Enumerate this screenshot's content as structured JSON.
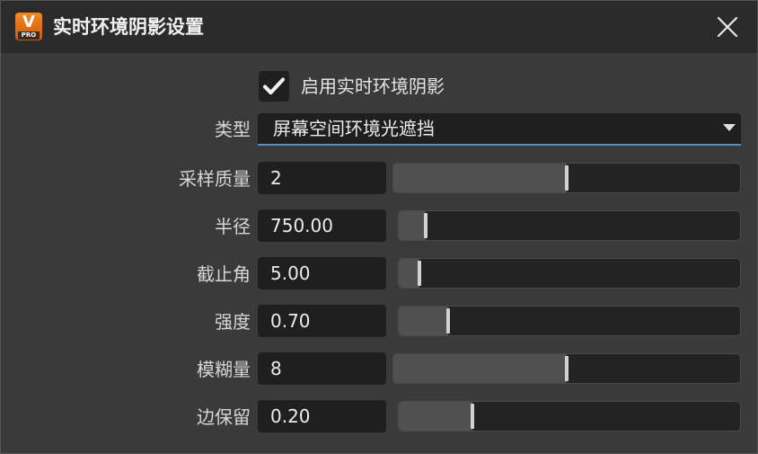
{
  "window": {
    "title": "实时环境阴影设置",
    "logo_letter": "V",
    "logo_badge": "PRO",
    "accent_color": "#5a8cc8",
    "logo_color": "#f08a24"
  },
  "enable": {
    "label": "启用实时环境阴影",
    "checked": true
  },
  "type": {
    "label": "类型",
    "value": "屏幕空间环境光遮挡"
  },
  "params": [
    {
      "label": "采样质量",
      "value": "2",
      "fraction": 0.5
    },
    {
      "label": "半径",
      "value": "750.00",
      "fraction": 0.08
    },
    {
      "label": "截止角",
      "value": "5.00",
      "fraction": 0.06
    },
    {
      "label": "强度",
      "value": "0.70",
      "fraction": 0.145
    },
    {
      "label": "模糊量",
      "value": "8",
      "fraction": 0.5
    },
    {
      "label": "边保留",
      "value": "0.20",
      "fraction": 0.215
    }
  ]
}
